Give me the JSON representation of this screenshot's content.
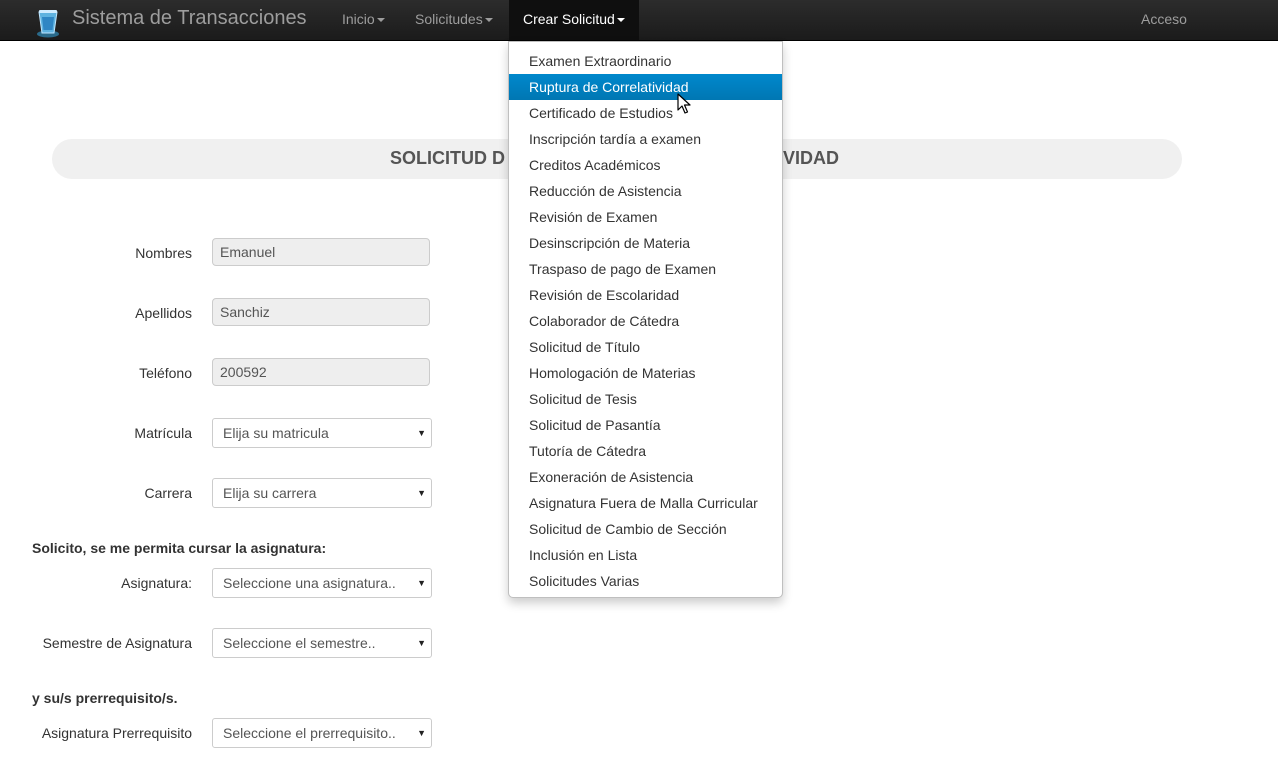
{
  "navbar": {
    "brand": "Sistema de Transacciones",
    "items": [
      {
        "label": "Inicio"
      },
      {
        "label": "Solicitudes"
      },
      {
        "label": "Crear Solicitud"
      }
    ],
    "login": "Acceso"
  },
  "page": {
    "title_left": "SOLICITUD D",
    "title_right": "VIDAD"
  },
  "form": {
    "nombres_label": "Nombres",
    "nombres_value": "Emanuel",
    "apellidos_label": "Apellidos",
    "apellidos_value": "Sanchiz",
    "telefono_label": "Teléfono",
    "telefono_value": "200592",
    "matricula_label": "Matrícula",
    "matricula_value": "Elija su matricula",
    "carrera_label": "Carrera",
    "carrera_value": "Elija su carrera",
    "section1": "Solicito, se me permita cursar la asignatura:",
    "asignatura_label": "Asignatura:",
    "asignatura_value": "Seleccione una asignatura..",
    "semestre_label": "Semestre de Asignatura",
    "semestre_value": "Seleccione el semestre..",
    "section2": "y su/s prerrequisito/s.",
    "prerrequisito_label": "Asignatura Prerrequisito",
    "prerrequisito_value": "Seleccione el prerrequisito.."
  },
  "dropdown": {
    "highlighted_index": 1,
    "items": [
      "Examen Extraordinario",
      "Ruptura de Correlatividad",
      "Certificado de Estudios",
      "Inscripción tardía a examen",
      "Creditos Académicos",
      "Reducción de Asistencia",
      "Revisión de Examen",
      "Desinscripción de Materia",
      "Traspaso de pago de Examen",
      "Revisión de Escolaridad",
      "Colaborador de Cátedra",
      "Solicitud de Título",
      "Homologación de Materias",
      "Solicitud de Tesis",
      "Solicitud de Pasantía",
      "Tutoría de Cátedra",
      "Exoneración de Asistencia",
      "Asignatura Fuera de Malla Curricular",
      "Solicitud de Cambio de Sección",
      "Inclusión en Lista",
      "Solicitudes Varias"
    ]
  }
}
